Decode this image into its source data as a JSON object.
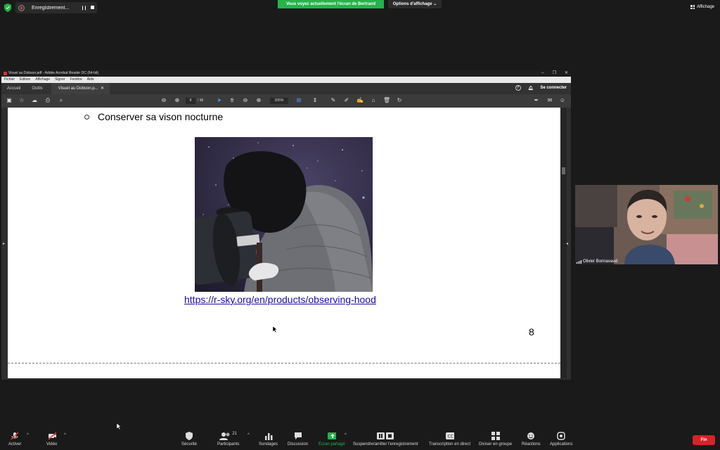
{
  "top": {
    "recording_label": "Enregistrement...",
    "share_banner": "Vous voyez actuellement l'écran de Bertrand",
    "view_options": "Options d'affichage ⌄",
    "view_button": "Affichage"
  },
  "acrobat": {
    "window_title": "Visuel au Dobson.pdf - Adobe Acrobat Reader DC (64-bit)",
    "menu": [
      "Fichier",
      "Edition",
      "Affichage",
      "Signer",
      "Fenêtre",
      "Aide"
    ],
    "tabs": [
      "Accueil",
      "Outils"
    ],
    "doc_tab": "Visuel au Dobson.p...",
    "sign_in": "Se connecter",
    "page_current": "8",
    "page_total": "/ 36",
    "zoom": "205%"
  },
  "slide": {
    "bullet": "Conserver sa vison nocturne",
    "link": "https://r-sky.org/en/products/observing-hood",
    "page_number": "8"
  },
  "participant": {
    "name": "Olivier Bonnavaud"
  },
  "bottombar": {
    "unmute": "Activer",
    "video": "Vidéo",
    "security": "Sécurité",
    "participants": "Participants",
    "participants_count": "21",
    "polls": "Sondages",
    "chat": "Discussion",
    "share": "Écran partagé",
    "recording": "Suspendre/arrêter l'enregistrement",
    "captions": "Transcription en direct",
    "breakout": "Diviser en groupe",
    "reactions": "Réactions",
    "apps": "Applications",
    "end": "Fin"
  },
  "colors": {
    "share_green": "#25b34a",
    "end_red": "#d4232a",
    "link_blue": "#1a0dab"
  }
}
